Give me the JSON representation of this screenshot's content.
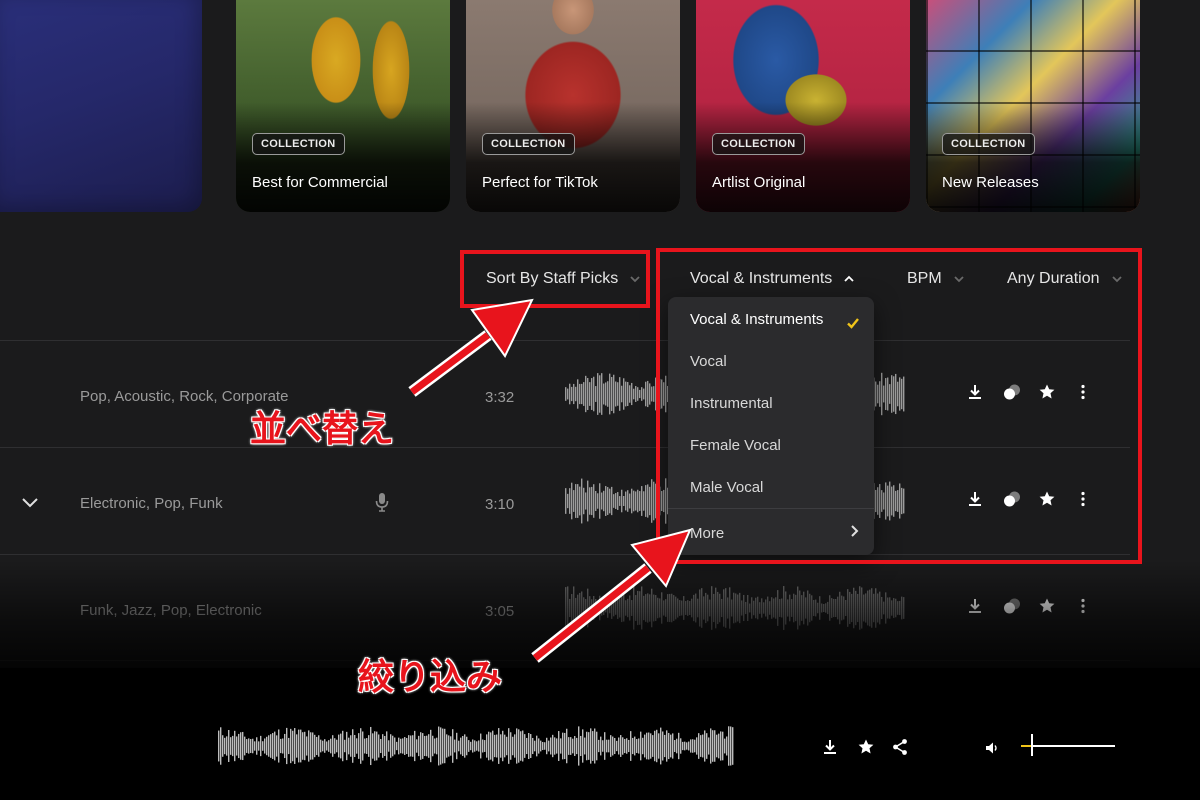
{
  "collections": [
    {
      "badge": "COLLECTION",
      "title": "Best for Commercial"
    },
    {
      "badge": "COLLECTION",
      "title": "Perfect for TikTok"
    },
    {
      "badge": "COLLECTION",
      "title": "Artlist Original"
    },
    {
      "badge": "COLLECTION",
      "title": "New Releases"
    }
  ],
  "filters": {
    "sort": "Sort By Staff Picks",
    "vocal": "Vocal & Instruments",
    "bpm": "BPM",
    "duration": "Any Duration"
  },
  "dropdown": {
    "selected": "Vocal & Instruments",
    "items": [
      "Vocal & Instruments",
      "Vocal",
      "Instrumental",
      "Female Vocal",
      "Male Vocal"
    ],
    "more": "More"
  },
  "tracks": [
    {
      "tags": "Pop,  Acoustic,  Rock,  Corporate",
      "duration": "3:32"
    },
    {
      "tags": "Electronic,  Pop,  Funk",
      "duration": "3:10"
    },
    {
      "tags": "Funk,  Jazz,  Pop,  Electronic",
      "duration": "3:05"
    }
  ],
  "annotations": {
    "sort_label": "並べ替え",
    "filter_label": "絞り込み",
    "color": "#e8141c"
  },
  "player": {
    "volume": 0.12
  },
  "colors": {
    "accent": "#f0c419",
    "background": "#1b1b1c"
  }
}
